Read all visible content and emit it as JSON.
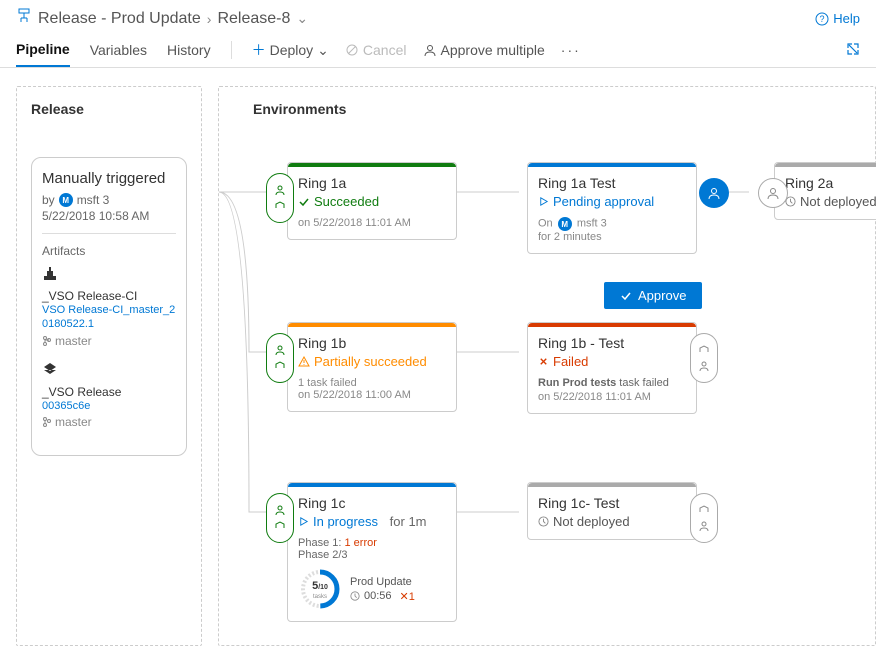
{
  "header": {
    "project": "Release - Prod Update",
    "release": "Release-8",
    "help": "Help"
  },
  "tabs": {
    "pipeline": "Pipeline",
    "variables": "Variables",
    "history": "History",
    "deploy": "Deploy",
    "cancel": "Cancel",
    "approve_multiple": "Approve multiple"
  },
  "release": {
    "panel_title": "Release",
    "trigger": "Manually triggered",
    "by_label": "by",
    "by_user": "msft 3",
    "date": "5/22/2018 10:58 AM",
    "artifacts_label": "Artifacts",
    "artifacts": [
      {
        "name": "_VSO Release-CI",
        "sub": "VSO Release-CI_master_20180522.1",
        "branch": "master"
      },
      {
        "name": "_VSO Release",
        "sub": "00365c6e",
        "branch": "master"
      }
    ]
  },
  "environments": {
    "panel_title": "Environments",
    "cards": {
      "ring1a": {
        "name": "Ring 1a",
        "status": "Succeeded",
        "time": "on 5/22/2018 11:01 AM"
      },
      "ring1a_test": {
        "name": "Ring 1a Test",
        "status": "Pending approval",
        "time1": "On",
        "time_user": "msft 3",
        "time2": "for 2 minutes"
      },
      "ring2a": {
        "name": "Ring 2a",
        "status": "Not deployed"
      },
      "ring1b": {
        "name": "Ring 1b",
        "status": "Partially succeeded",
        "time": "1 task failed\non 5/22/2018 11:00 AM"
      },
      "ring1b_test": {
        "name": "Ring 1b - Test",
        "status": "Failed",
        "fail_task": "Run Prod tests",
        "fail_suffix": "task failed",
        "time": "on 5/22/2018 11:01 AM"
      },
      "ring1c": {
        "name": "Ring 1c",
        "status": "In progress",
        "status_time": "for 1m",
        "phase1": "Phase 1:",
        "phase1_err": "1 error",
        "phase2": "Phase 2/3",
        "task_count": "5",
        "task_total": "/10",
        "task_label": "tasks",
        "prod_update": "Prod Update",
        "duration": "00:56",
        "xcount": "1"
      },
      "ring1c_test": {
        "name": "Ring 1c- Test",
        "status": "Not deployed"
      }
    },
    "approve_button": "Approve"
  }
}
